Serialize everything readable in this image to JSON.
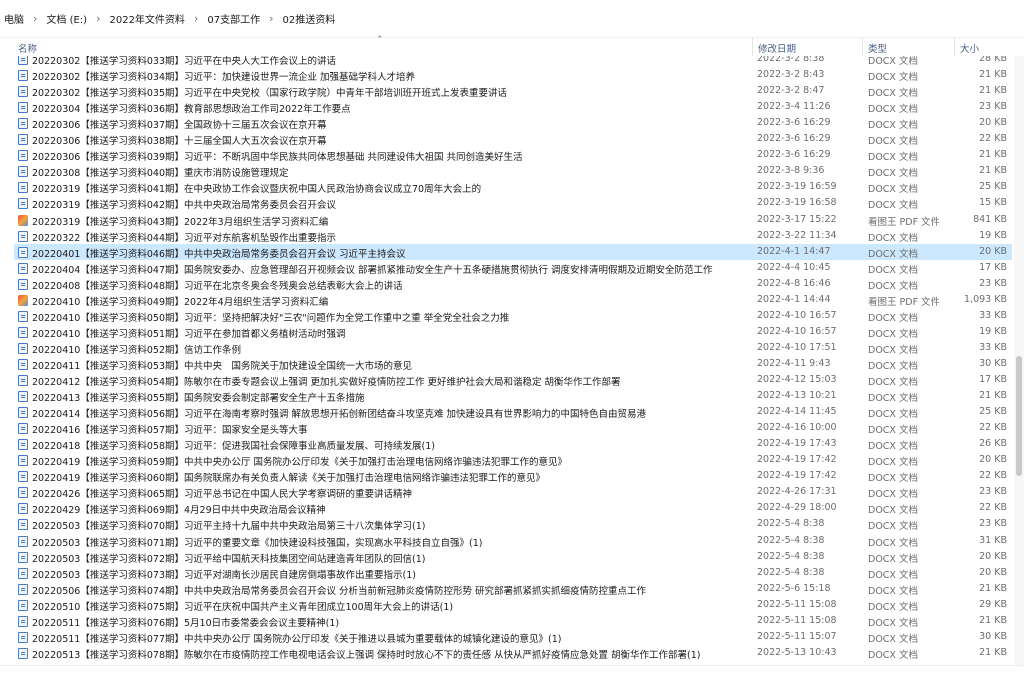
{
  "breadcrumb": [
    "电脑",
    "文档 (E:)",
    "2022年文件资料",
    "07支部工作",
    "02推送资料"
  ],
  "columns": {
    "name": "名称",
    "date": "修改日期",
    "type": "类型",
    "size": "大小"
  },
  "files": [
    {
      "name": "20220302【推送学习资料033期】习近平在中央人大工作会议上的讲话",
      "date": "2022-3-2 8:38",
      "type": "DOCX 文档",
      "size": "28 KB",
      "icon": "docx"
    },
    {
      "name": "20220302【推送学习资料034期】习近平：加快建设世界一流企业 加强基础学科人才培养",
      "date": "2022-3-2 8:43",
      "type": "DOCX 文档",
      "size": "21 KB",
      "icon": "docx"
    },
    {
      "name": "20220302【推送学习资料035期】习近平在中央党校（国家行政学院）中青年干部培训班开班式上发表重要讲话",
      "date": "2022-3-2 8:47",
      "type": "DOCX 文档",
      "size": "21 KB",
      "icon": "docx"
    },
    {
      "name": "20220304【推送学习资料036期】教育部思想政治工作司2022年工作要点",
      "date": "2022-3-4 11:26",
      "type": "DOCX 文档",
      "size": "23 KB",
      "icon": "docx"
    },
    {
      "name": "20220306【推送学习资料037期】全国政协十三届五次会议在京开幕",
      "date": "2022-3-6 16:29",
      "type": "DOCX 文档",
      "size": "20 KB",
      "icon": "docx"
    },
    {
      "name": "20220306【推送学习资料038期】十三届全国人大五次会议在京开幕",
      "date": "2022-3-6 16:29",
      "type": "DOCX 文档",
      "size": "22 KB",
      "icon": "docx"
    },
    {
      "name": "20220306【推送学习资料039期】习近平：不断巩固中华民族共同体思想基础 共同建设伟大祖国 共同创造美好生活",
      "date": "2022-3-6 16:29",
      "type": "DOCX 文档",
      "size": "21 KB",
      "icon": "docx"
    },
    {
      "name": "20220308【推送学习资料040期】重庆市消防设施管理规定",
      "date": "2022-3-8 9:36",
      "type": "DOCX 文档",
      "size": "21 KB",
      "icon": "docx"
    },
    {
      "name": "20220319【推送学习资料041期】在中央政协工作会议暨庆祝中国人民政治协商会议成立70周年大会上的",
      "date": "2022-3-19 16:59",
      "type": "DOCX 文档",
      "size": "25 KB",
      "icon": "docx"
    },
    {
      "name": "20220319【推送学习资料042期】中共中央政治局常务委员会召开会议",
      "date": "2022-3-19 16:58",
      "type": "DOCX 文档",
      "size": "15 KB",
      "icon": "docx"
    },
    {
      "name": "20220319【推送学习资料043期】2022年3月组织生活学习资料汇编",
      "date": "2022-3-17 15:22",
      "type": "看图王 PDF 文件",
      "size": "841 KB",
      "icon": "pdf"
    },
    {
      "name": "20220322【推送学习资料044期】习近平对东航客机坠毁作出重要指示",
      "date": "2022-3-22 11:34",
      "type": "DOCX 文档",
      "size": "19 KB",
      "icon": "docx"
    },
    {
      "name": "20220401【推送学习资料046期】中共中央政治局常务委员会召开会议 习近平主持会议",
      "date": "2022-4-1 14:47",
      "type": "DOCX 文档",
      "size": "20 KB",
      "icon": "docx",
      "selected": true
    },
    {
      "name": "20220404【推送学习资料047期】国务院安委办、应急管理部召开视频会议 部署抓紧推动安全生产十五条硬措施贯彻执行 调度安排清明假期及近期安全防范工作",
      "date": "2022-4-4 10:45",
      "type": "DOCX 文档",
      "size": "17 KB",
      "icon": "docx"
    },
    {
      "name": "20220408【推送学习资料048期】习近平在北京冬奥会冬残奥会总结表彰大会上的讲话",
      "date": "2022-4-8 16:46",
      "type": "DOCX 文档",
      "size": "23 KB",
      "icon": "docx"
    },
    {
      "name": "20220410【推送学习资料049期】2022年4月组织生活学习资料汇编",
      "date": "2022-4-1 14:44",
      "type": "看图王 PDF 文件",
      "size": "1,093 KB",
      "icon": "pdf"
    },
    {
      "name": "20220410【推送学习资料050期】习近平：坚持把解决好\"三农\"问题作为全党工作重中之重 举全党全社会之力推",
      "date": "2022-4-10 16:57",
      "type": "DOCX 文档",
      "size": "33 KB",
      "icon": "docx"
    },
    {
      "name": "20220410【推送学习资料051期】习近平在参加首都义务植树活动时强调",
      "date": "2022-4-10 16:57",
      "type": "DOCX 文档",
      "size": "19 KB",
      "icon": "docx"
    },
    {
      "name": "20220410【推送学习资料052期】信访工作条例",
      "date": "2022-4-10 17:51",
      "type": "DOCX 文档",
      "size": "33 KB",
      "icon": "docx"
    },
    {
      "name": "20220411【推送学习资料053期】中共中央　国务院关于加快建设全国统一大市场的意见",
      "date": "2022-4-11 9:43",
      "type": "DOCX 文档",
      "size": "30 KB",
      "icon": "docx"
    },
    {
      "name": "20220412【推送学习资料054期】陈敏尔在市委专题会议上强调 更加扎实做好疫情防控工作 更好维护社会大局和谐稳定 胡衡华作工作部署",
      "date": "2022-4-12 15:03",
      "type": "DOCX 文档",
      "size": "17 KB",
      "icon": "docx"
    },
    {
      "name": "20220413【推送学习资料055期】国务院安委会制定部署安全生产十五条措施",
      "date": "2022-4-13 10:21",
      "type": "DOCX 文档",
      "size": "21 KB",
      "icon": "docx"
    },
    {
      "name": "20220414【推送学习资料056期】习近平在海南考察时强调 解放思想开拓创新团结奋斗攻坚克难 加快建设具有世界影响力的中国特色自由贸易港",
      "date": "2022-4-14 11:45",
      "type": "DOCX 文档",
      "size": "25 KB",
      "icon": "docx"
    },
    {
      "name": "20220416【推送学习资料057期】习近平：国家安全是头等大事",
      "date": "2022-4-16 10:00",
      "type": "DOCX 文档",
      "size": "22 KB",
      "icon": "docx"
    },
    {
      "name": "20220418【推送学习资料058期】习近平：促进我国社会保障事业高质量发展、可持续发展(1)",
      "date": "2022-4-19 17:43",
      "type": "DOCX 文档",
      "size": "26 KB",
      "icon": "docx"
    },
    {
      "name": "20220419【推送学习资料059期】中共中央办公厅 国务院办公厅印发《关于加强打击治理电信网络诈骗违法犯罪工作的意见》",
      "date": "2022-4-19 17:42",
      "type": "DOCX 文档",
      "size": "20 KB",
      "icon": "docx"
    },
    {
      "name": "20220419【推送学习资料060期】国务院联席办有关负责人解读《关于加强打击治理电信网络诈骗违法犯罪工作的意见》",
      "date": "2022-4-19 17:42",
      "type": "DOCX 文档",
      "size": "22 KB",
      "icon": "docx"
    },
    {
      "name": "20220426【推送学习资料065期】习近平总书记在中国人民大学考察调研的重要讲话精神",
      "date": "2022-4-26 17:31",
      "type": "DOCX 文档",
      "size": "23 KB",
      "icon": "docx"
    },
    {
      "name": "20220429【推送学习资料069期】4月29日中共中央政治局会议精神",
      "date": "2022-4-29 18:00",
      "type": "DOCX 文档",
      "size": "22 KB",
      "icon": "docx"
    },
    {
      "name": "20220503【推送学习资料070期】习近平主持十九届中共中央政治局第三十八次集体学习(1)",
      "date": "2022-5-4 8:38",
      "type": "DOCX 文档",
      "size": "23 KB",
      "icon": "docx"
    },
    {
      "name": "20220503【推送学习资料071期】习近平的重要文章《加快建设科技强国，实现高水平科技自立自强》(1)",
      "date": "2022-5-4 8:38",
      "type": "DOCX 文档",
      "size": "31 KB",
      "icon": "docx"
    },
    {
      "name": "20220503【推送学习资料072期】习近平给中国航天科技集团空间站建造青年团队的回信(1)",
      "date": "2022-5-4 8:38",
      "type": "DOCX 文档",
      "size": "20 KB",
      "icon": "docx"
    },
    {
      "name": "20220503【推送学习资料073期】习近平对湖南长沙居民自建房倒塌事故作出重要指示(1)",
      "date": "2022-5-4 8:38",
      "type": "DOCX 文档",
      "size": "20 KB",
      "icon": "docx"
    },
    {
      "name": "20220506【推送学习资料074期】中共中央政治局常务委员会召开会议 分析当前新冠肺炎疫情防控形势 研究部署抓紧抓实抓细疫情防控重点工作",
      "date": "2022-5-6 15:18",
      "type": "DOCX 文档",
      "size": "21 KB",
      "icon": "docx"
    },
    {
      "name": "20220510【推送学习资料075期】习近平在庆祝中国共产主义青年团成立100周年大会上的讲话(1)",
      "date": "2022-5-11 15:08",
      "type": "DOCX 文档",
      "size": "29 KB",
      "icon": "docx"
    },
    {
      "name": "20220511【推送学习资料076期】5月10日市委常委会会议主要精神(1)",
      "date": "2022-5-11 15:08",
      "type": "DOCX 文档",
      "size": "21 KB",
      "icon": "docx"
    },
    {
      "name": "20220511【推送学习资料077期】中共中央办公厅 国务院办公厅印发《关于推进以县城为重要载体的城镇化建设的意见》(1)",
      "date": "2022-5-11 15:07",
      "type": "DOCX 文档",
      "size": "30 KB",
      "icon": "docx"
    },
    {
      "name": "20220513【推送学习资料078期】陈敏尔在市疫情防控工作电视电话会议上强调 保持时时放心不下的责任感 从快从严抓好疫情应急处置 胡衡华作工作部署(1)",
      "date": "2022-5-13 10:43",
      "type": "DOCX 文档",
      "size": "21 KB",
      "icon": "docx"
    }
  ]
}
